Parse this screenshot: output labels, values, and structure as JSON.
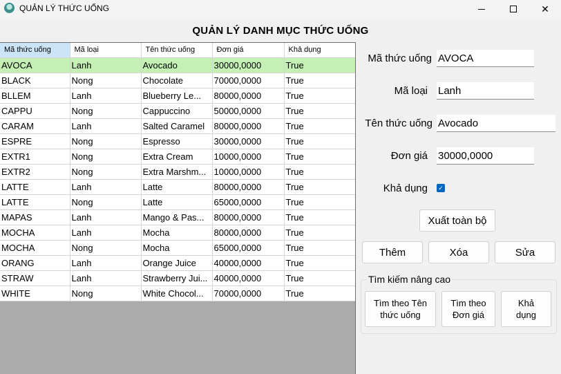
{
  "window": {
    "title": "QUẢN LÝ THỨC UỐNG",
    "minimize_label": "—",
    "maximize_label": "☐",
    "close_label": "✕"
  },
  "page_title": "QUẢN LÝ DANH MỤC THỨC UỐNG",
  "table": {
    "columns": [
      "Mã thức uống",
      "Mã loại",
      "Tên thức uống",
      "Đơn giá",
      "Khả dụng"
    ],
    "rows": [
      [
        "AVOCA",
        "Lanh",
        "Avocado",
        "30000,0000",
        "True"
      ],
      [
        "BLACK",
        "Nong",
        "Chocolate",
        "70000,0000",
        "True"
      ],
      [
        "BLLEM",
        "Lanh",
        "Blueberry Le...",
        "80000,0000",
        "True"
      ],
      [
        "CAPPU",
        "Nong",
        "Cappuccino",
        "50000,0000",
        "True"
      ],
      [
        "CARAM",
        "Lanh",
        "Salted Caramel",
        "80000,0000",
        "True"
      ],
      [
        "ESPRE",
        "Nong",
        "Espresso",
        "30000,0000",
        "True"
      ],
      [
        "EXTR1",
        "Nong",
        "Extra Cream",
        "10000,0000",
        "True"
      ],
      [
        "EXTR2",
        "Nong",
        "Extra Marshm...",
        "10000,0000",
        "True"
      ],
      [
        "LATTE",
        "Lanh",
        "Latte",
        "80000,0000",
        "True"
      ],
      [
        "LATTE",
        "Nong",
        "Latte",
        "65000,0000",
        "True"
      ],
      [
        "MAPAS",
        "Lanh",
        "Mango & Pas...",
        "80000,0000",
        "True"
      ],
      [
        "MOCHA",
        "Lanh",
        "Mocha",
        "80000,0000",
        "True"
      ],
      [
        "MOCHA",
        "Nong",
        "Mocha",
        "65000,0000",
        "True"
      ],
      [
        "ORANG",
        "Lanh",
        "Orange Juice",
        "40000,0000",
        "True"
      ],
      [
        "STRAW",
        "Lanh",
        "Strawberry Jui...",
        "40000,0000",
        "True"
      ],
      [
        "WHITE",
        "Nong",
        "White Chocol...",
        "70000,0000",
        "True"
      ]
    ],
    "selected_row": 0
  },
  "form": {
    "ma_thuc_uong_label": "Mã thức uống",
    "ma_thuc_uong_value": "AVOCA",
    "ma_loai_label": "Mã loại",
    "ma_loai_value": "Lanh",
    "ten_thuc_uong_label": "Tên thức uống",
    "ten_thuc_uong_value": "Avocado",
    "don_gia_label": "Đơn giá",
    "don_gia_value": "30000,0000",
    "kha_dung_label": "Khả dụng",
    "kha_dung_checked": true,
    "check_glyph": "✓"
  },
  "buttons": {
    "export_all": "Xuất toàn bộ",
    "add": "Thêm",
    "delete": "Xóa",
    "edit": "Sửa"
  },
  "search": {
    "group_title": "Tìm kiếm nâng cao",
    "by_name_line1": "Tìm theo Tên",
    "by_name_line2": "thức uống",
    "by_price_line1": "Tìm theo",
    "by_price_line2": "Đơn giá",
    "by_available_line1": "Khả",
    "by_available_line2": "dụng"
  },
  "colors": {
    "selected_row": "#c4f0b4",
    "header_active": "#cce4f7",
    "checkbox": "#0067c0",
    "grid_empty": "#ababab"
  }
}
